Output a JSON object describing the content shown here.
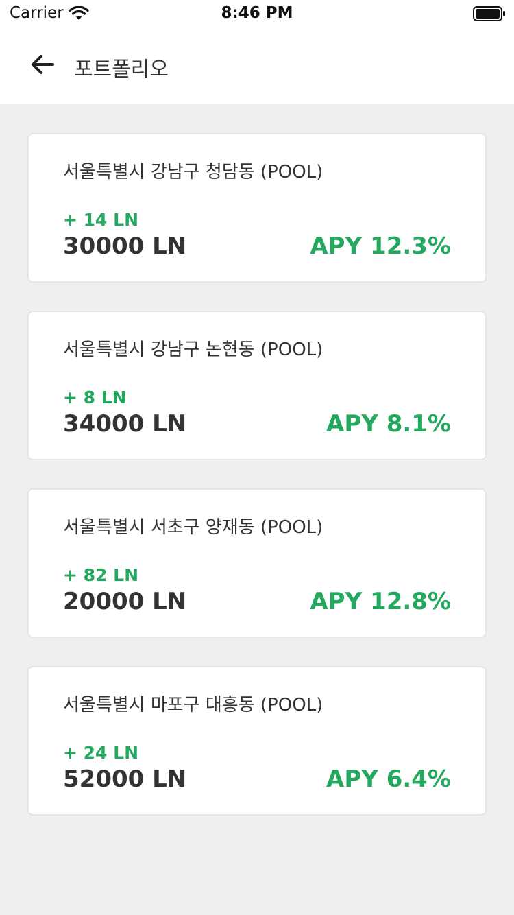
{
  "status_bar": {
    "carrier": "Carrier",
    "time": "8:46 PM",
    "wifi_icon": "wifi-icon",
    "battery_icon": "battery-full-icon"
  },
  "nav": {
    "back_icon": "arrow-left-icon",
    "title": "포트폴리오"
  },
  "colors": {
    "accent_green": "#24a85f",
    "background": "#efefef",
    "card": "#ffffff",
    "text": "#333333"
  },
  "pools": [
    {
      "name": "서울특별시 강남구 청담동 (POOL)",
      "change": "+ 14 LN",
      "amount": "30000 LN",
      "apy": "APY 12.3%"
    },
    {
      "name": "서울특별시 강남구 논현동 (POOL)",
      "change": "+ 8 LN",
      "amount": "34000 LN",
      "apy": "APY 8.1%"
    },
    {
      "name": "서울특별시 서초구 양재동 (POOL)",
      "change": "+ 82 LN",
      "amount": "20000 LN",
      "apy": "APY 12.8%"
    },
    {
      "name": "서울특별시 마포구 대흥동 (POOL)",
      "change": "+ 24 LN",
      "amount": "52000 LN",
      "apy": "APY 6.4%"
    }
  ]
}
